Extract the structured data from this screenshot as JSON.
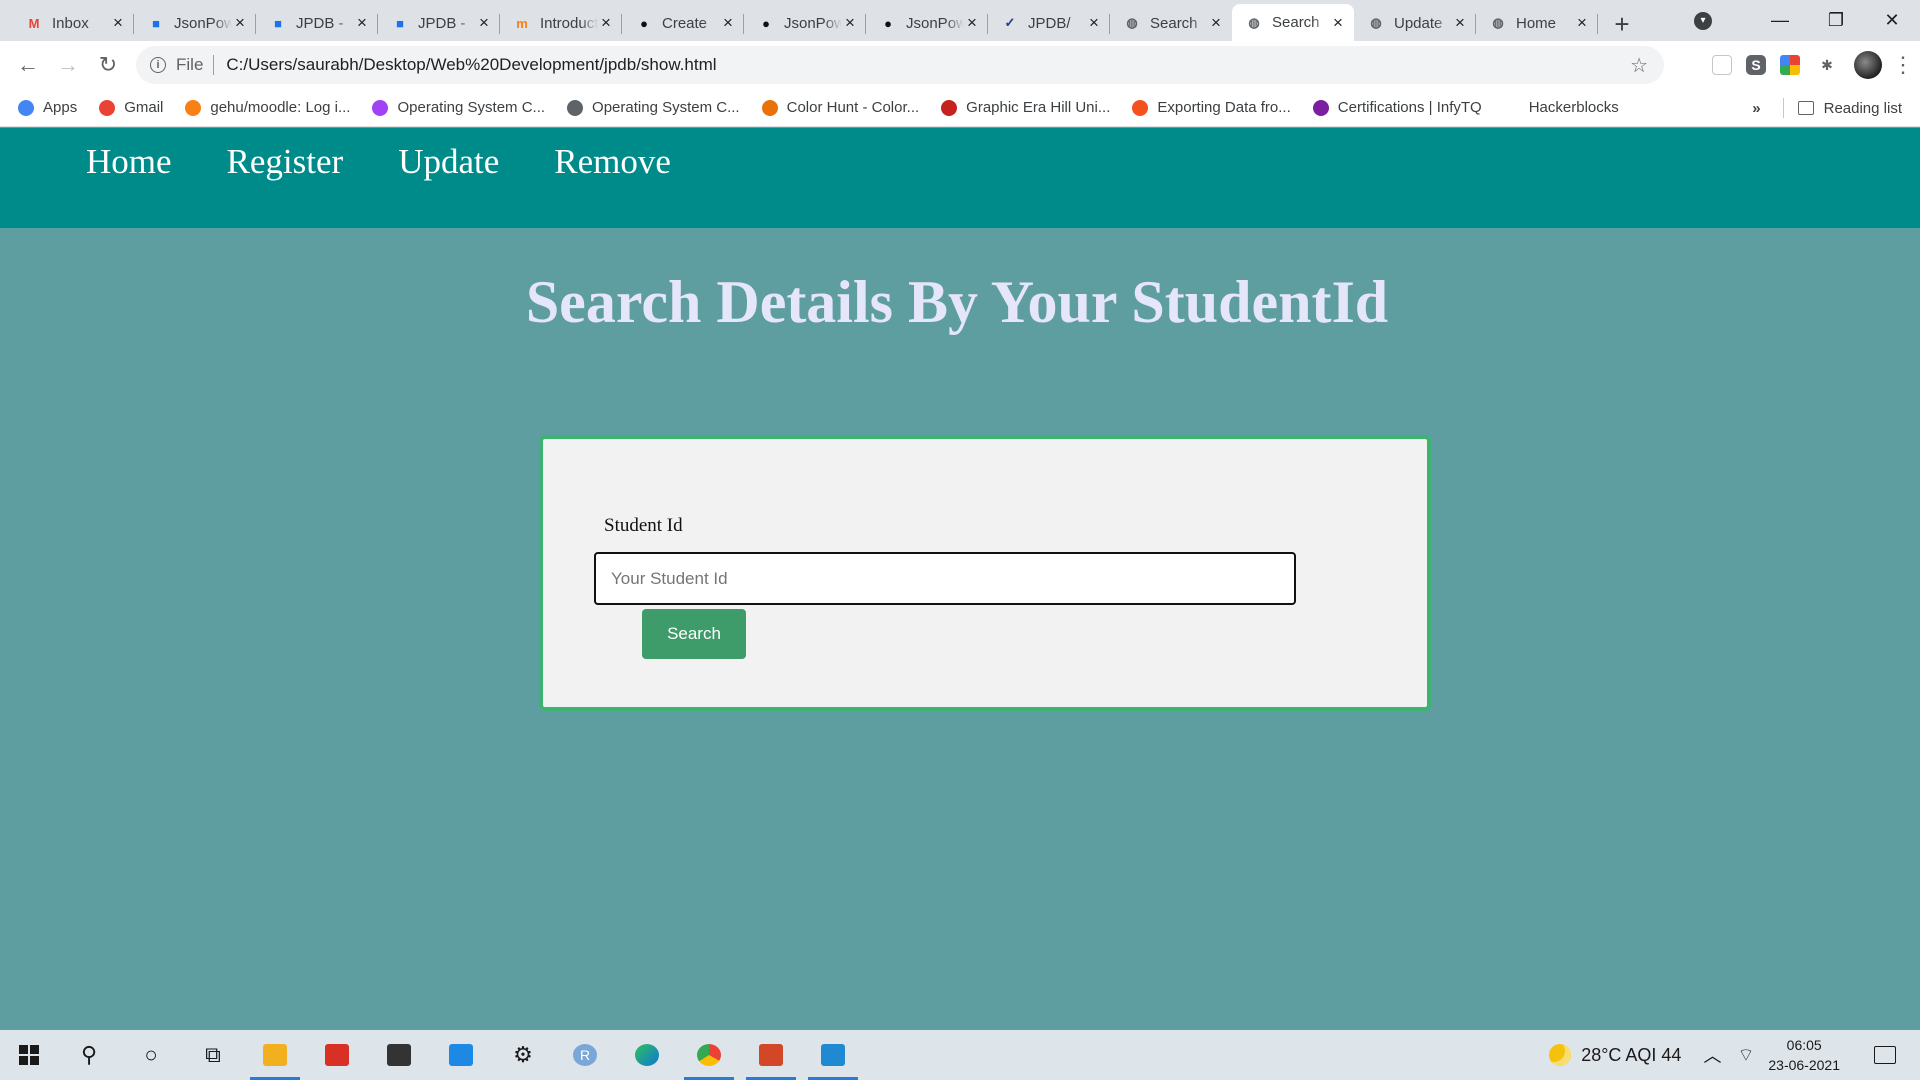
{
  "browser": {
    "tabs": [
      {
        "title": "Inbox",
        "icon": "gmail-icon",
        "color": "#ea4335",
        "glyph": "M"
      },
      {
        "title": "JsonPowerDB",
        "icon": "jpdb-icon",
        "color": "#1a73e8",
        "glyph": "■"
      },
      {
        "title": "JPDB - ",
        "icon": "jpdb-icon",
        "color": "#1a73e8",
        "glyph": "■"
      },
      {
        "title": "JPDB - ",
        "icon": "jpdb-icon",
        "color": "#1a73e8",
        "glyph": "■"
      },
      {
        "title": "Introduction",
        "icon": "moodle-icon",
        "color": "#f98012",
        "glyph": "m"
      },
      {
        "title": "Create",
        "icon": "github-icon",
        "color": "#111111",
        "glyph": "●"
      },
      {
        "title": "JsonPowerDB",
        "icon": "github-icon",
        "color": "#111111",
        "glyph": "●"
      },
      {
        "title": "JsonPowerDB",
        "icon": "github-icon",
        "color": "#111111",
        "glyph": "●"
      },
      {
        "title": "JPDB/",
        "icon": "check-circle-icon",
        "color": "#1f3c88",
        "glyph": "✓"
      },
      {
        "title": "Search",
        "icon": "globe-icon",
        "color": "#5f6368",
        "glyph": "◍"
      },
      {
        "title": "Search",
        "icon": "globe-icon",
        "color": "#5f6368",
        "glyph": "◍",
        "active": true
      },
      {
        "title": "Update",
        "icon": "globe-icon",
        "color": "#5f6368",
        "glyph": "◍"
      },
      {
        "title": "Home",
        "icon": "globe-icon",
        "color": "#5f6368",
        "glyph": "◍"
      }
    ],
    "new_tab_label": "+",
    "window_controls": {
      "minimize": "—",
      "restore": "❐",
      "close": "✕"
    },
    "address": {
      "scheme": "File",
      "url": "C:/Users/saurabh/Desktop/Web%20Development/jpdb/show.html"
    },
    "bookmarks": [
      {
        "label": "Apps",
        "icon": "apps-grid-icon",
        "color": "#4285f4"
      },
      {
        "label": "Gmail",
        "icon": "gmail-icon",
        "color": "#ea4335"
      },
      {
        "label": "gehu/moodle: Log i...",
        "icon": "moodle-icon",
        "color": "#f98012"
      },
      {
        "label": "Operating System C...",
        "icon": "m-circle-icon",
        "color": "#a142f4"
      },
      {
        "label": "Operating System C...",
        "icon": "globe-icon",
        "color": "#5f6368"
      },
      {
        "label": "Color Hunt - Color...",
        "icon": "color-hunt-icon",
        "color": "#e8710a"
      },
      {
        "label": "Graphic Era Hill Uni...",
        "icon": "university-icon",
        "color": "#c5221f"
      },
      {
        "label": "Exporting Data fro...",
        "icon": "export-icon",
        "color": "#f4511e"
      },
      {
        "label": "Certifications | InfyTQ",
        "icon": "infytq-icon",
        "color": "#7b1fa2"
      },
      {
        "label": "Hackerblocks",
        "icon": "",
        "color": "#ffffff"
      }
    ],
    "reading_list_label": "Reading list",
    "overflow_label": "»"
  },
  "page": {
    "nav": [
      "Home",
      "Register",
      "Update",
      "Remove"
    ],
    "title": "Search Details By Your StudentId",
    "form": {
      "label": "Student Id",
      "placeholder": "Your Student Id",
      "value": "",
      "button": "Search"
    },
    "colors": {
      "background": "#5f9ea0",
      "nav_bar": "#008b8b",
      "title_text": "#e6e6fa",
      "card_border": "#3cb371",
      "button": "#3e9b6a"
    }
  },
  "taskbar": {
    "weather": "28°C  AQI 44",
    "time": "06:05",
    "date": "23-06-2021"
  }
}
